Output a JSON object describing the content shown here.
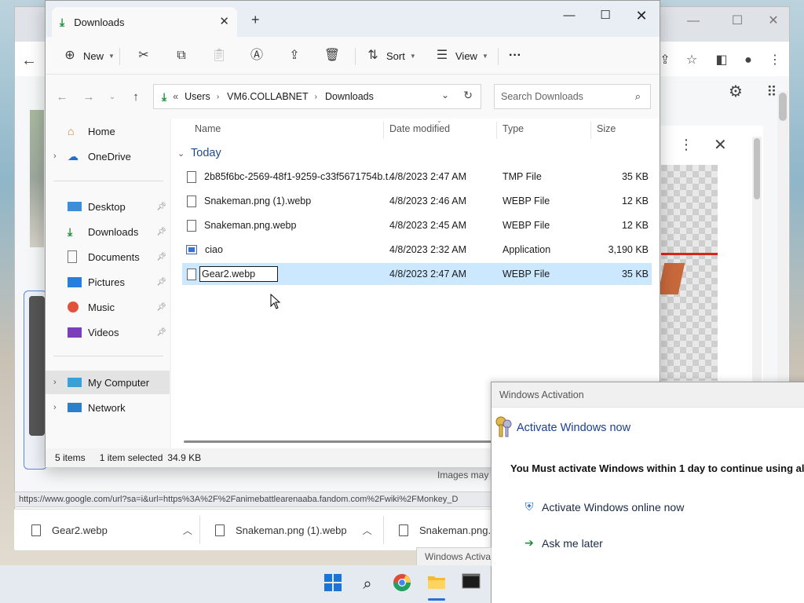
{
  "explorer": {
    "tab_title": "Downloads",
    "toolbar": {
      "new_label": "New",
      "sort_label": "Sort",
      "view_label": "View",
      "more_label": "···"
    },
    "address": {
      "overflow": "«",
      "crumbs": [
        "Users",
        "VM6.COLLABNET",
        "Downloads"
      ]
    },
    "search_placeholder": "Search Downloads",
    "sidebar": {
      "top": [
        {
          "label": "Home",
          "icon": "home-icon"
        },
        {
          "label": "OneDrive",
          "icon": "cloud-icon"
        }
      ],
      "pinned": [
        {
          "label": "Desktop",
          "icon": "desktop-icon"
        },
        {
          "label": "Downloads",
          "icon": "download-icon"
        },
        {
          "label": "Documents",
          "icon": "documents-icon"
        },
        {
          "label": "Pictures",
          "icon": "pictures-icon"
        },
        {
          "label": "Music",
          "icon": "music-icon"
        },
        {
          "label": "Videos",
          "icon": "videos-icon"
        }
      ],
      "bottom": [
        {
          "label": "My Computer",
          "icon": "computer-icon",
          "selected": true
        },
        {
          "label": "Network",
          "icon": "network-icon"
        }
      ]
    },
    "columns": {
      "name": "Name",
      "date": "Date modified",
      "type": "Type",
      "size": "Size"
    },
    "group_label": "Today",
    "files": [
      {
        "name": "2b85f6bc-2569-48f1-9259-c33f5671754b.t...",
        "date": "4/8/2023 2:47 AM",
        "type": "TMP File",
        "size": "35 KB"
      },
      {
        "name": "Snakeman.png (1).webp",
        "date": "4/8/2023 2:46 AM",
        "type": "WEBP File",
        "size": "12 KB"
      },
      {
        "name": "Snakeman.png.webp",
        "date": "4/8/2023 2:45 AM",
        "type": "WEBP File",
        "size": "12 KB"
      },
      {
        "name": "ciao",
        "date": "4/8/2023 2:32 AM",
        "type": "Application",
        "size": "3,190 KB"
      },
      {
        "name": "Gear2.webp",
        "date": "4/8/2023 2:47 AM",
        "type": "WEBP File",
        "size": "35 KB",
        "renaming": true
      }
    ],
    "status": {
      "items": "5 items",
      "selected": "1 item selected",
      "size": "34.9 KB"
    }
  },
  "browser": {
    "status_url": "https://www.google.com/url?sa=i&url=https%3A%2F%2Fanimebattlearenaaba.fandom.com%2Fwiki%2FMonkey_D",
    "downloads": [
      {
        "name": "Gear2.webp"
      },
      {
        "name": "Snakeman.png (1).webp"
      },
      {
        "name": "Snakeman.png.v"
      }
    ],
    "images_note": "Images may",
    "popup_tab": "Windows Activa"
  },
  "activation": {
    "title": "Windows Activation",
    "heading": "Activate Windows now",
    "message": "You Must activate Windows within 1 day to continue using al",
    "option_online": "Activate Windows online now",
    "option_later": "Ask me later"
  },
  "colors": {
    "accent": "#1a8f3c",
    "selection": "#cce8ff",
    "link": "#1a3f92"
  }
}
